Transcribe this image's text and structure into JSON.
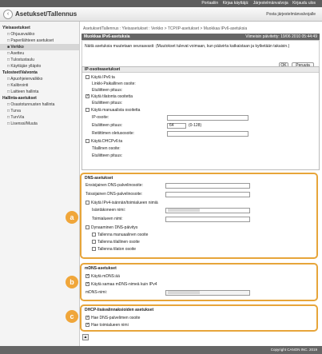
{
  "topbar": {
    "links": [
      "Portaaliin",
      "Kirjaa käyttäjä:",
      "Järjestelmänvalvoja",
      "Kirjaudu ulos"
    ]
  },
  "header": {
    "title": "Asetukset/Tallennus",
    "mail_link": "Posta järjestelmänvalvojalle"
  },
  "sidebar": {
    "sections": [
      {
        "title": "Yleisasetukset",
        "items": [
          "Ohjausvaikko",
          "Paperilähteen asetukset",
          "Verkko",
          "Asetteu",
          "Tulostustaulu",
          "Käyttäjän ylläpito"
        ]
      },
      {
        "title": "Tulosteet/Valvonta",
        "items": [
          "Apuohjeienvalikko",
          "Kalibrointi",
          "Laitteen hallinta"
        ]
      },
      {
        "title": "Hallinta-asetukset",
        "items": [
          "Osastotunnusten hallinta",
          "Turva",
          "TurvVia",
          "Lisenssi/Muuta"
        ]
      }
    ]
  },
  "main": {
    "breadcrumb": "Asetukset/Tallennus : Yleisasetukset : Verkko > TCP/IP-asetukset > Muokkaa IPv6-asetuksia",
    "page_title": "Muokkaa IPv6-asetuksia",
    "last_updated": "Viimeisin päivitetty: 19/06 2010 05:44:49",
    "message": "Näitä asetuksia muutetaan seuraavasti: (Muutokset tulevat voimaan, kun päävirta katkaistaan ja kytketään takaisin.)",
    "ok_label": "OK",
    "cancel_label": "Peruuta",
    "ipv6_section": {
      "title": "IP-osoiteasetukset",
      "use_ipv6": "Käytä IPv6:ta",
      "link_local_label": "Linkki-Paikallinen osoite:",
      "prefix_length_label": "Etuliitteen pituus:",
      "stateless": "Käytä tilatonta osoitetta",
      "prefix_length_label2": "Etuliitteen pituus:",
      "manual": "Käytä manuaalista osoitetta",
      "ip_address_label": "IP-osoite:",
      "prefix_length_label3": "Etuliitteen pituus:",
      "prefix_value": "64",
      "prefix_range": "(0-128)",
      "default_router_label": "Reitittimen oletusosoite:",
      "dhcpv6": "Käytä DHCPv6:ta",
      "stateful_label": "Tilallinen osoite:",
      "prefix_length_label4": "Etuliitteen pituus:"
    },
    "dns_section": {
      "title": "DNS-asetukset",
      "primary_label": "Ensisijainen DNS-palvelinosoite:",
      "secondary_label": "Toissijainen DNS-palvelinosoite:",
      "use_ipv4_names": "Käytä IPv4-isännän/toimialueen nimiä",
      "host_label": "Isäntäkoneen nimi:",
      "domain_label": "Toimialueen nimi:",
      "dynamic_dns": "Dynaaminen DNS-päivitys",
      "register_manual": "Tallenna manuaalinen osoite",
      "register_stateful": "Tallenna tilallinen osoite",
      "register_stateless": "Tallenna tilaton osoite"
    },
    "mdns_section": {
      "title": "mDNS-asetukset",
      "use_mdns": "Käytä mDNS:ää",
      "same_name": "Käytä samaa mDNS-nimeä kuin IPv4",
      "name_label": "mDNS-nimi:"
    },
    "dhcp_section": {
      "title": "DHCP-lisävalinnaksioiden asetukset",
      "get_dns": "Hae DNS-palvelimen osoite",
      "get_domain": "Hae toimialueen nimi"
    },
    "callouts": [
      "a",
      "b",
      "c"
    ]
  },
  "footer": {
    "copyright": "Copyright CANON INC. 2019"
  },
  "colors": {
    "highlight": "#e7a53a",
    "marker": "#f0a63a",
    "bar": "#666666"
  }
}
